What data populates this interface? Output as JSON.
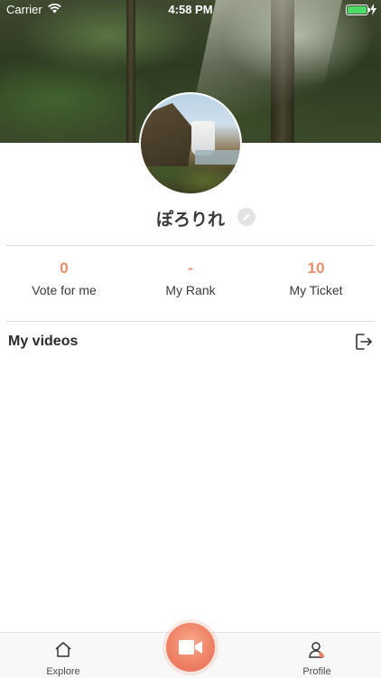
{
  "status_bar": {
    "carrier": "Carrier",
    "time": "4:58 PM"
  },
  "profile": {
    "name": "ぽろりれ",
    "avatar_icon": "avatar-waterfall-photo",
    "edit_icon": "pencil-icon"
  },
  "stats": [
    {
      "value": "0",
      "label": "Vote for me"
    },
    {
      "value": "-",
      "label": "My Rank"
    },
    {
      "value": "10",
      "label": "My Ticket"
    }
  ],
  "videos_section": {
    "title": "My videos",
    "logout_icon": "logout-icon"
  },
  "tab_bar": {
    "explore_label": "Explore",
    "profile_label": "Profile",
    "record_icon": "video-camera-icon"
  },
  "colors": {
    "accent": "#e98e6a",
    "record_button": "#ee7f62",
    "battery": "#4cd964"
  }
}
